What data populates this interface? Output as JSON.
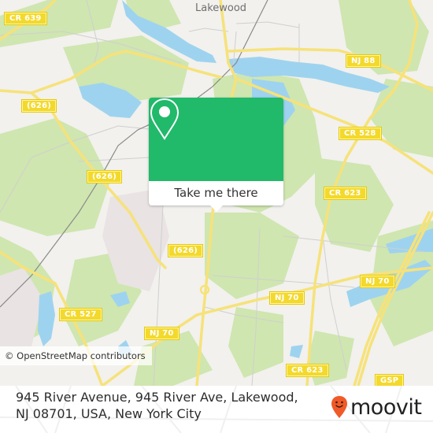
{
  "map": {
    "place_labels": [
      {
        "id": "lakewood",
        "text": "Lakewood"
      }
    ],
    "road_shields": [
      {
        "id": "cr639",
        "text": "CR 639"
      },
      {
        "id": "626-a",
        "text": "(626)"
      },
      {
        "id": "626-b",
        "text": "(626)"
      },
      {
        "id": "626-c",
        "text": "(626)"
      },
      {
        "id": "nj88",
        "text": "NJ 88"
      },
      {
        "id": "cr528",
        "text": "CR 528"
      },
      {
        "id": "cr623-a",
        "text": "CR 623"
      },
      {
        "id": "cr527",
        "text": "CR 527"
      },
      {
        "id": "nj70-a",
        "text": "NJ 70"
      },
      {
        "id": "nj70-b",
        "text": "NJ 70"
      },
      {
        "id": "nj70-c",
        "text": "NJ 70"
      },
      {
        "id": "cr623-b",
        "text": "CR 623"
      },
      {
        "id": "gsp",
        "text": "GSP"
      }
    ],
    "attribution": "© OpenStreetMap contributors",
    "colors": {
      "land": "#f2f1ee",
      "park": "#cfe6b0",
      "water": "#9ed3ef",
      "road": "#f6e27a",
      "shield": "#f3d92c",
      "urban": "#e9e3e3"
    }
  },
  "popup": {
    "icon": "map-pin-icon",
    "button_label": "Take me there",
    "color": "#21b96a"
  },
  "footer": {
    "address": "945 River Avenue, 945 River Ave, Lakewood, NJ 08701, USA, New York City",
    "brand": "moovit",
    "brand_icon": "moovit-smiley-pin-icon",
    "brand_color": "#f05a28"
  }
}
